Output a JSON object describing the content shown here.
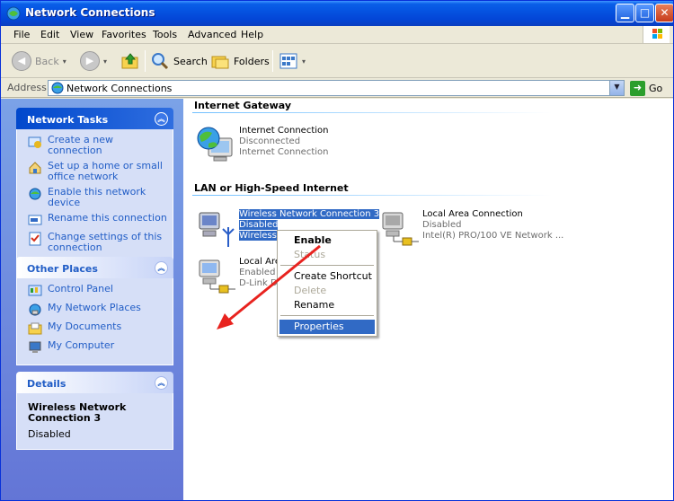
{
  "window": {
    "title": "Network Connections"
  },
  "menubar": [
    "File",
    "Edit",
    "View",
    "Favorites",
    "Tools",
    "Advanced",
    "Help"
  ],
  "toolbar": {
    "back": "Back",
    "search": "Search",
    "folders": "Folders"
  },
  "address": {
    "label": "Address",
    "value": "Network Connections",
    "go": "Go"
  },
  "network_tasks": {
    "title": "Network Tasks",
    "items": [
      "Create a new connection",
      "Set up a home or small office network",
      "Enable this network device",
      "Rename this connection",
      "Change settings of this connection"
    ]
  },
  "other_places": {
    "title": "Other Places",
    "items": [
      "Control Panel",
      "My Network Places",
      "My Documents",
      "My Computer"
    ]
  },
  "details": {
    "title": "Details",
    "name": "Wireless Network Connection 3",
    "status": "Disabled"
  },
  "groups": {
    "gateway": "Internet Gateway",
    "lan": "LAN or High-Speed Internet"
  },
  "connections": {
    "internet": {
      "name": "Internet Connection",
      "status": "Disconnected",
      "type": "Internet Connection"
    },
    "wireless": {
      "name": "Wireless Network Connection 3",
      "status": "Disabled",
      "type": "Wireless"
    },
    "local1": {
      "name": "Local Area Connection",
      "status": "Disabled",
      "type": "Intel(R) PRO/100 VE Network ..."
    },
    "local2": {
      "name": "Local Are",
      "status": "Enabled",
      "type": "D-Link DF"
    }
  },
  "context_menu": {
    "enable": "Enable",
    "status": "Status",
    "create_shortcut": "Create Shortcut",
    "delete": "Delete",
    "rename": "Rename",
    "properties": "Properties"
  },
  "colors": {
    "annotation_arrow": "#e8231f",
    "selection": "#316ac5",
    "task_link": "#215dc6"
  }
}
